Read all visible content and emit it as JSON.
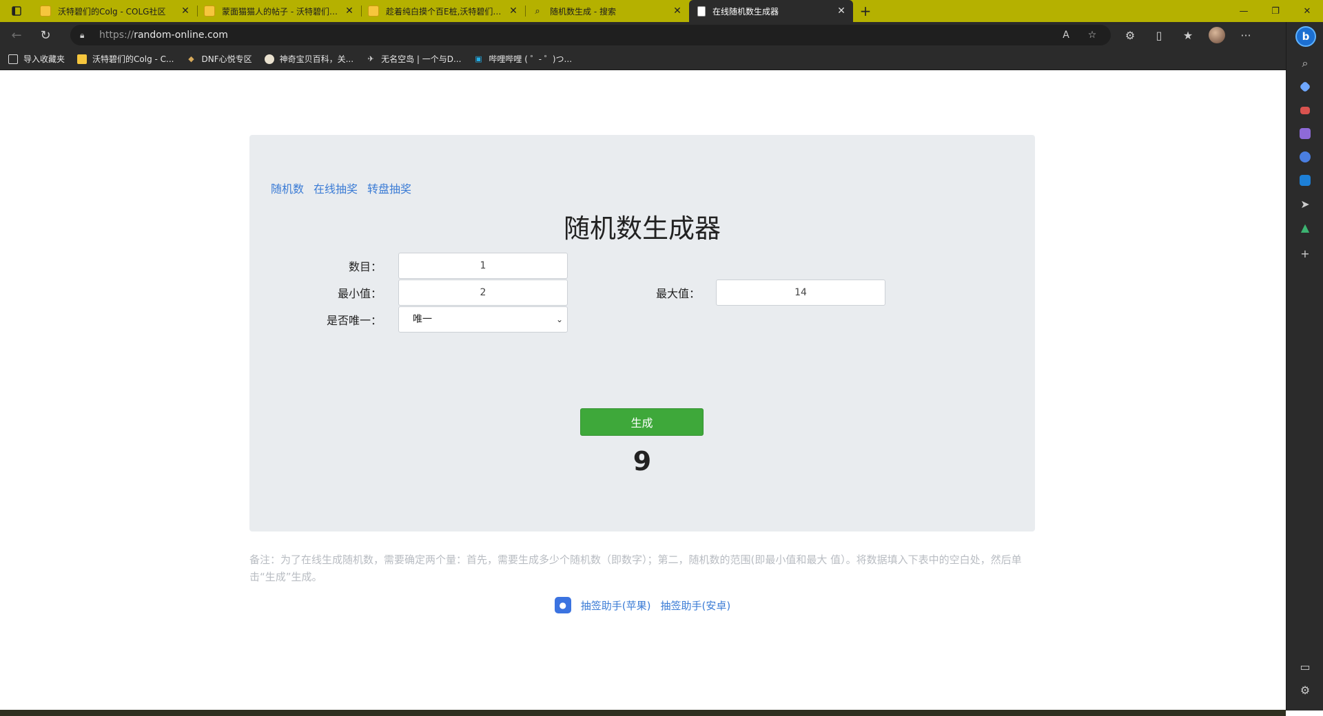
{
  "browser": {
    "tabs": [
      {
        "title": "沃特碧们的Colg - COLG社区",
        "icon": "colg-favicon"
      },
      {
        "title": "蒙面猫猫人的帖子 - 沃特碧们的Colg",
        "icon": "colg-favicon"
      },
      {
        "title": "趁着纯白摸个百E桩,沃特碧们的Colg",
        "icon": "colg-favicon"
      },
      {
        "title": "随机数生成 - 搜索",
        "icon": "search-icon"
      },
      {
        "title": "在线随机数生成器",
        "icon": "page-icon",
        "active": true
      }
    ],
    "address": {
      "scheme": "https://",
      "host": "random-online.com"
    },
    "favorites": [
      {
        "label": "导入收藏夹",
        "icon": "folder-icon"
      },
      {
        "label": "沃特碧们的Colg - C...",
        "icon": "colg-favicon"
      },
      {
        "label": "DNF心悦专区",
        "icon": "dnf-icon"
      },
      {
        "label": "神奇宝贝百科，关...",
        "icon": "pokemon-icon"
      },
      {
        "label": "无名空岛 | 一个与D...",
        "icon": "island-icon"
      },
      {
        "label": "哔哩哔哩 ( ゜- ゜)つ...",
        "icon": "bilibili-icon"
      }
    ],
    "colors": {
      "tabbar": "#b5b100",
      "chrome": "#2b2b2b"
    }
  },
  "page": {
    "nav": [
      "随机数",
      "在线抽奖",
      "转盘抽奖"
    ],
    "title": "随机数生成器",
    "form": {
      "count_label": "数目：",
      "count_value": "1",
      "min_label": "最小值：",
      "min_value": "2",
      "max_label": "最大值：",
      "max_value": "14",
      "unique_label": "是否唯一：",
      "unique_value": "唯一"
    },
    "generate_button": "生成",
    "result": "9",
    "note": "备注：为了在线生成随机数，需要确定两个量：首先，需要生成多少个随机数（即数字）；第二，随机数的范围(即最小值和最大 值）。将数据填入下表中的空白处，然后单击“生成”生成。",
    "apps": {
      "ios": "抽签助手(苹果)",
      "android": "抽签助手(安卓)"
    },
    "colors": {
      "panel": "#e9ecef",
      "button": "#3ea83a",
      "link": "#3a7bd5"
    }
  }
}
